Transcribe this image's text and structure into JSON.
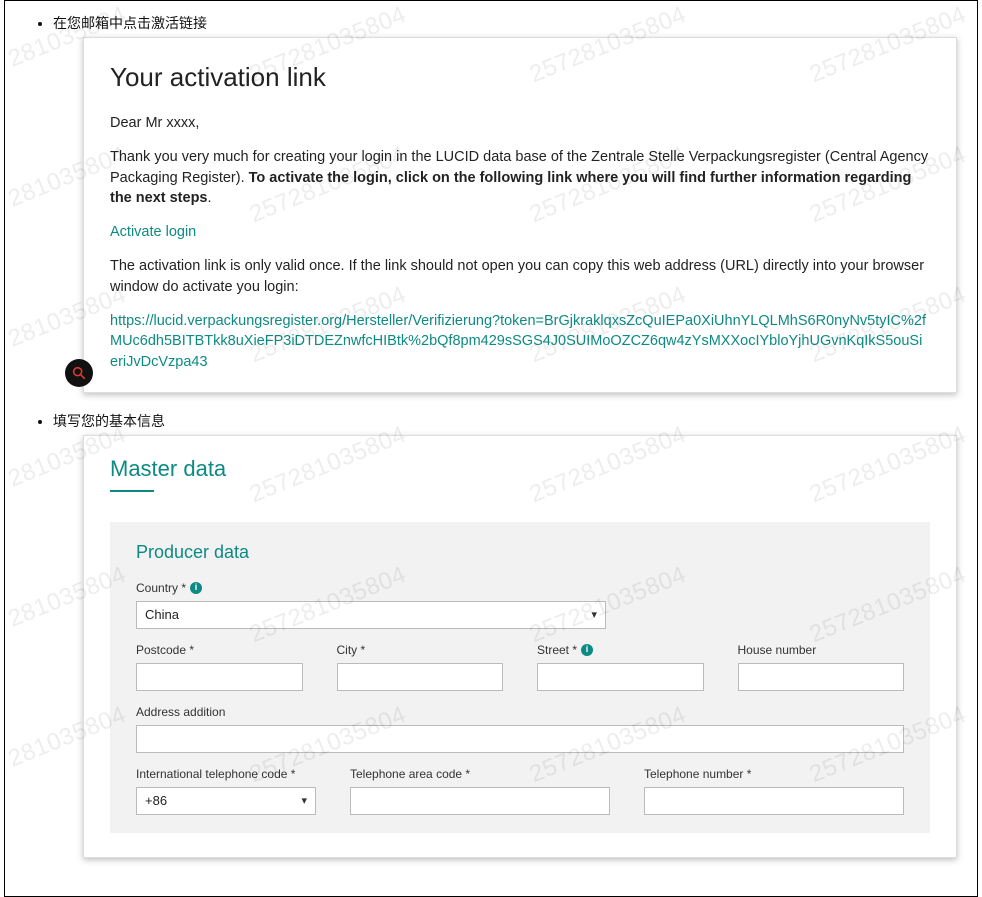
{
  "watermark": "257281035804",
  "steps": {
    "0": "在您邮箱中点击激活链接",
    "1": "填写您的基本信息"
  },
  "email": {
    "title": "Your activation link",
    "greeting": "Dear Mr xxxx,",
    "body_pre": "Thank you very much for creating your login in the LUCID data base of the Zentrale Stelle Verpackungsregister (Central Agency Packaging Register). ",
    "body_bold": "To activate the login, click on the following link where you will find further information regarding the next steps",
    "body_post": ".",
    "activate_label": "Activate login",
    "validity": "The activation link is only valid once. If the link should not open you can copy this web address (URL) directly into your browser window do activate you login:",
    "url": "https://lucid.verpackungsregister.org/Hersteller/Verifizierung?token=BrGjkraklqxsZcQuIEPa0XiUhnYLQLMhS6R0nyNv5tyIC%2fMUc6dh5BITBTkk8uXieFP3iDTDEZnwfcHIBtk%2bQf8pm429sSGS4J0SUIMoOZCZ6qw4zYsMXXocIYbloYjhUGvnKqIkS5ouSieriJvDcVzpa43"
  },
  "form": {
    "master_title": "Master data",
    "panel_title": "Producer data",
    "country_label": "Country *",
    "country_value": "China",
    "postcode_label": "Postcode *",
    "city_label": "City *",
    "street_label": "Street *",
    "house_label": "House number",
    "address_add_label": "Address addition",
    "intl_code_label": "International telephone code *",
    "intl_code_value": "+86",
    "area_code_label": "Telephone area code *",
    "phone_number_label": "Telephone number *"
  }
}
